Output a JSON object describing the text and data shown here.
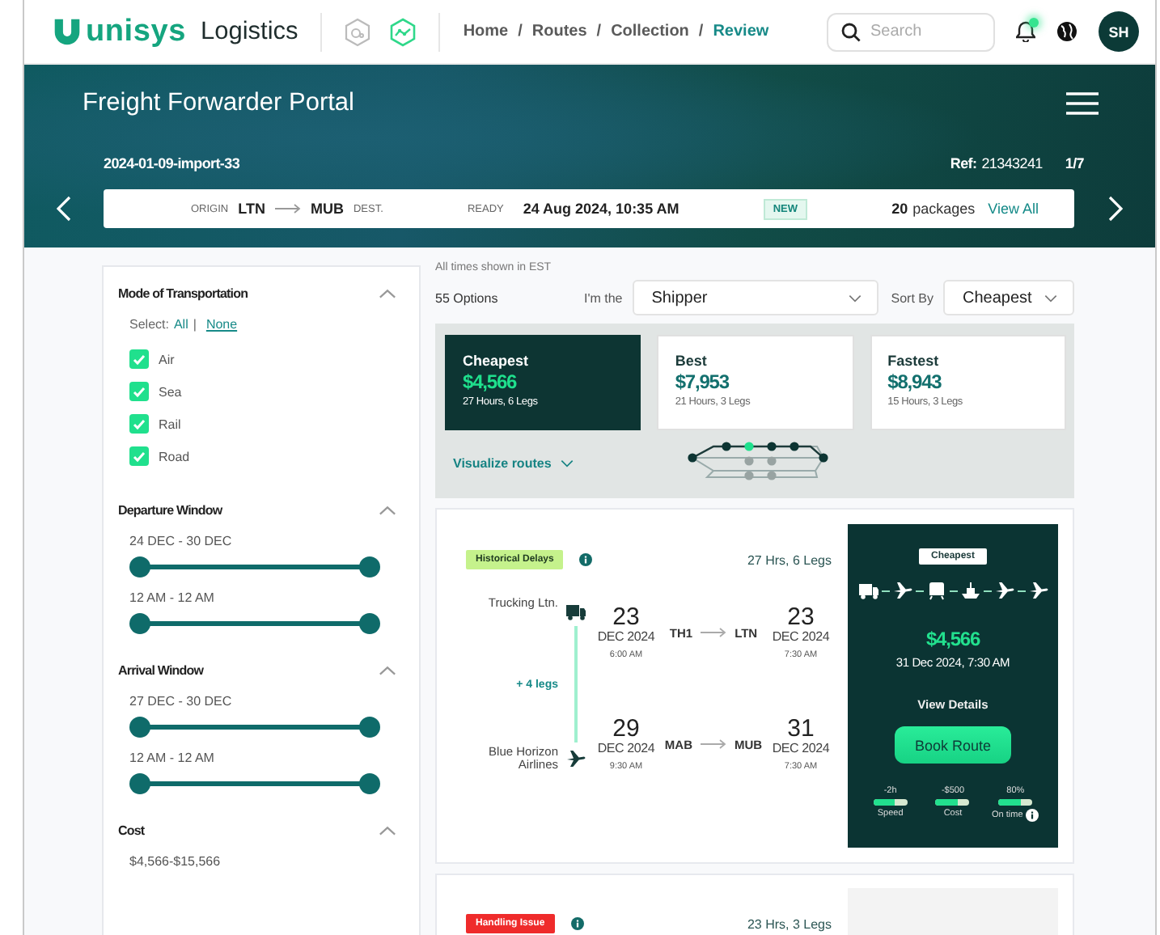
{
  "header": {
    "logo": "unisys",
    "app_name": "Logistics",
    "breadcrumbs": [
      {
        "label": "Home",
        "selected": false,
        "separator": "/"
      },
      {
        "label": "Routes",
        "selected": false,
        "separator": "/"
      },
      {
        "label": "Collection",
        "selected": false,
        "separator": "/"
      },
      {
        "label": "Review",
        "selected": true
      }
    ],
    "search": {
      "placeholder": "Search"
    },
    "notifications": {
      "unread": true
    },
    "avatar": "SH"
  },
  "hero": {
    "title": "Freight Forwarder Portal",
    "shipment_id": "2024-01-09-import-33",
    "ref_label": "Ref:",
    "ref": "21343241",
    "page": "1/7",
    "summary": {
      "origin_label": "ORIGIN",
      "origin": "LTN",
      "destination": "MUB",
      "dest_label": "DEST.",
      "ready_label": "READY",
      "ready": "24 Aug 2024, 10:35 AM",
      "badge": "NEW",
      "package_count": "20",
      "packages_label": "packages",
      "view_all": "View All"
    }
  },
  "filters": {
    "sections": [
      {
        "title": "Mode of Transportation",
        "expanded": true,
        "kind": "checkboxes",
        "select_label": "Select:",
        "select_all": "All",
        "select_separator": "|",
        "select_none": "None",
        "options": [
          {
            "label": "Air",
            "checked": true
          },
          {
            "label": "Sea",
            "checked": true
          },
          {
            "label": "Rail",
            "checked": true
          },
          {
            "label": "Road",
            "checked": true
          }
        ]
      },
      {
        "title": "Departure Window",
        "expanded": true,
        "kind": "ranges",
        "ranges": [
          {
            "label": "24 DEC - 30 DEC",
            "level": 1
          },
          {
            "label": "12 AM - 12 AM",
            "level": 1
          }
        ]
      },
      {
        "title": "Arrival Window",
        "expanded": true,
        "kind": "ranges",
        "ranges": [
          {
            "label": "27 DEC - 30 DEC",
            "level": 1
          },
          {
            "label": "12 AM - 12 AM",
            "level": 1
          }
        ]
      },
      {
        "title": "Cost",
        "expanded": true,
        "kind": "ranges",
        "ranges": [
          {
            "label": "$4,566-$15,566"
          }
        ]
      }
    ]
  },
  "results": {
    "timezone_note": "All times shown in EST",
    "count": "55 Options",
    "role_label": "I'm the",
    "role": "Shipper",
    "sort_label": "Sort By",
    "sort": "Cheapest",
    "summaries": [
      {
        "title": "Cheapest",
        "price": "$4,566",
        "detail": "27 Hours, 6 Legs",
        "selected": true
      },
      {
        "title": "Best",
        "price": "$7,953",
        "detail": "21 Hours, 3 Legs",
        "selected": false
      },
      {
        "title": "Fastest",
        "price": "$8,943",
        "detail": "15 Hours, 3 Legs",
        "selected": false
      }
    ],
    "visualize": "Visualize routes"
  },
  "routes": [
    {
      "tag": "Historical Delays",
      "color": "#c5f28c",
      "duration": "27 Hrs, 6 Legs",
      "hidden_legs": "+ 4 legs",
      "legs": [
        {
          "carrier": "Trucking Ltn.",
          "kind": "truck",
          "depart": {
            "day": "23",
            "month": "DEC 2024",
            "time": "6:00 AM"
          },
          "from": "TH1",
          "to": "LTN",
          "arrive": {
            "day": "23",
            "month": "DEC 2024",
            "time": "7:30 AM"
          }
        },
        {
          "carrier": "Blue Horizon Airlines",
          "kind": "plane",
          "depart": {
            "day": "29",
            "month": "DEC 2024",
            "time": "9:30 AM"
          },
          "from": "MAB",
          "to": "MUB",
          "arrive": {
            "day": "31",
            "month": "DEC 2024",
            "time": "7:30 AM"
          }
        }
      ],
      "offer": {
        "badge": "Cheapest",
        "modes": [
          {
            "kind": "truck"
          },
          {
            "kind": "plane"
          },
          {
            "kind": "train"
          },
          {
            "kind": "ship"
          },
          {
            "kind": "plane"
          },
          {
            "kind": "plane"
          }
        ],
        "price": "$4,566",
        "arrival": "31 Dec 2024, 7:30 AM",
        "details": "View Details",
        "book": "Book Route",
        "metrics": [
          {
            "value": "-2h",
            "label": "Speed",
            "level": 0.65,
            "info": false
          },
          {
            "value": "-$500",
            "label": "Cost",
            "level": 0.65,
            "info": false
          },
          {
            "value": "80%",
            "label": "On time",
            "level": 0.65,
            "info": true
          }
        ]
      }
    },
    {
      "tag": "Handling Issue",
      "color": "#ef2b2b",
      "duration": "23 Hrs, 3 Legs"
    }
  ]
}
